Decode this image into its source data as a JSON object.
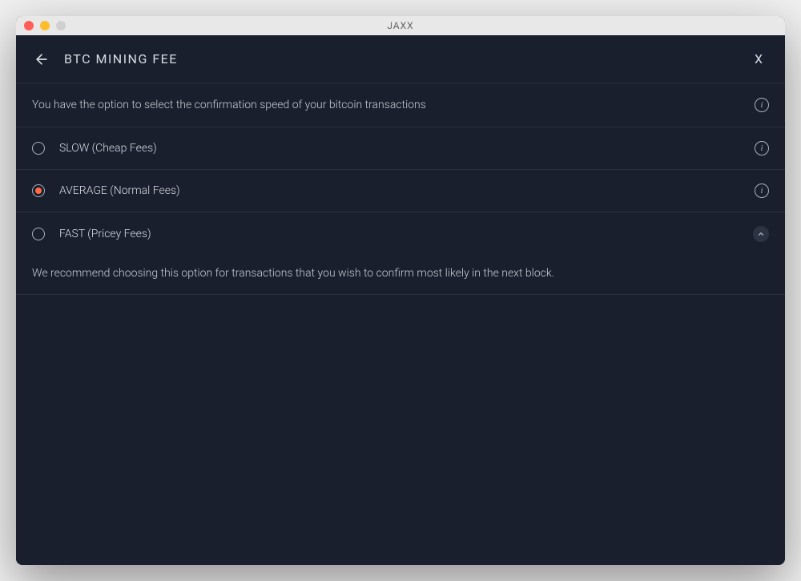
{
  "window": {
    "title": "JAXX"
  },
  "header": {
    "page_title": "BTC MINING FEE",
    "close": "X"
  },
  "description": "You have the option to select the confirmation speed of your bitcoin transactions",
  "options": [
    {
      "label": "SLOW (Cheap Fees)",
      "selected": false
    },
    {
      "label": "AVERAGE (Normal Fees)",
      "selected": true
    },
    {
      "label": "FAST (Pricey Fees)",
      "selected": false,
      "expanded": true,
      "detail": "We recommend choosing this option for transactions that you wish to confirm most likely in the next block."
    }
  ]
}
